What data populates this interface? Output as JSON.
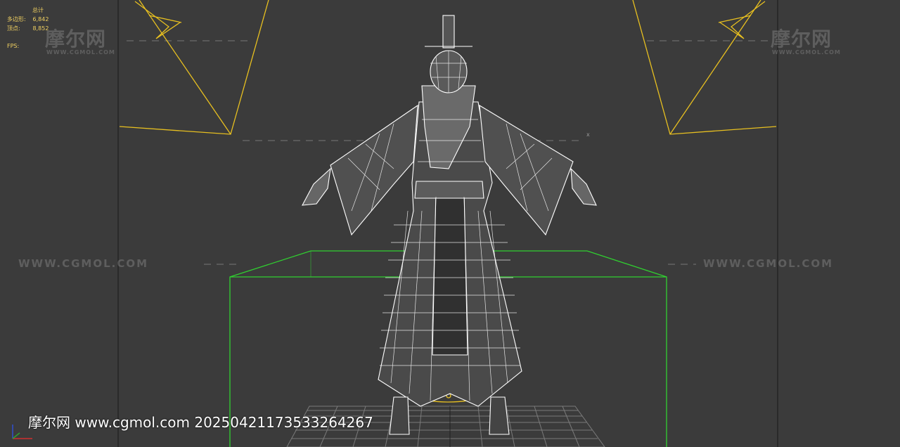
{
  "stats": {
    "total_label": "总计",
    "polys_label": "多边形:",
    "polys_value": "6,842",
    "verts_label": "顶点:",
    "verts_value": "8,852",
    "fps_label": "FPS:"
  },
  "watermarks": {
    "logo_text": "摩尔网",
    "logo_sub": "WWW.CGMOL.COM",
    "url_text": "WWW.CGMOL.COM"
  },
  "footer": {
    "text": "摩尔网 www.cgmol.com 20250421173533264267"
  },
  "colors": {
    "background": "#3b3b3b",
    "camera_lines": "#e8c020",
    "bounding_box": "#30d030",
    "wireframe": "#ffffff",
    "stats_text": "#f0d060",
    "axis_x": "#d03030",
    "axis_y": "#30a030",
    "axis_z": "#3050d0"
  }
}
